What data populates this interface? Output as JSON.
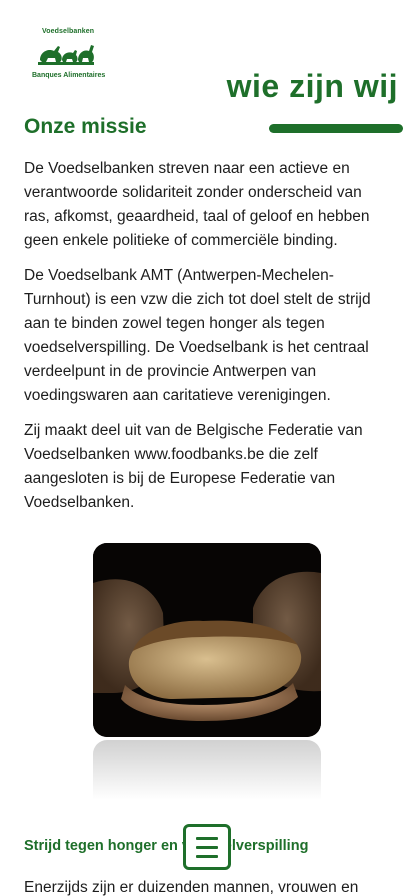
{
  "logo": {
    "top_text": "Voedselbanken",
    "bottom_text": "Banques Alimentaires"
  },
  "page_title": "wie zijn wij",
  "section_title": "Onze missie",
  "paragraphs": [
    "De Voedselbanken streven naar een actieve en verantwoorde solidariteit zonder onderscheid van ras, afkomst, geaardheid, taal of geloof en hebben geen enkele politieke of commerciële binding.",
    "De Voedselbank AMT (Antwerpen-Mechelen-Turnhout) is een vzw die zich tot doel stelt de strijd aan te binden zowel tegen honger als tegen voedselverspilling. De Voedselbank is het centraal verdeelpunt in de provincie Antwerpen van voedingswaren aan caritatieve verenigingen.",
    "Zij maakt deel uit van de Belgische Federatie van Voedselbanken www.foodbanks.be die zelf aangesloten is bij de Europese Federatie van Voedselbanken."
  ],
  "subheading": "Strijd tegen honger en voedselverspilling",
  "body_tail": "Enerzijds zijn er duizenden mannen, vrouwen en",
  "menu_icon": "hamburger-menu-icon",
  "colors": {
    "brand_green": "#1e6f2a",
    "text": "#1d1d1d",
    "background": "#ffffff"
  }
}
